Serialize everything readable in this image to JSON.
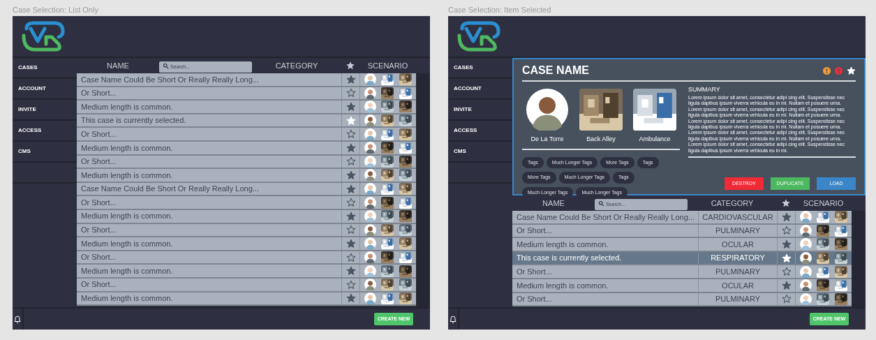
{
  "frames": [
    {
      "caption": "Case Selection: List Only",
      "sidebar": [
        "CASES",
        "ACCOUNT",
        "INVITE",
        "ACCESS",
        "CMS"
      ],
      "columns": {
        "name": "NAME",
        "category": "CATEGORY",
        "scenario": "SCENARIO"
      },
      "search": {
        "placeholder": "Search..."
      },
      "rows": [
        {
          "name": "Case Name Could Be Short Or Really Really Long...",
          "starred": true,
          "selected": false
        },
        {
          "name": "Or Short...",
          "starred": false,
          "selected": false
        },
        {
          "name": "Medium length is common.",
          "starred": true,
          "selected": false
        },
        {
          "name": "This case is currently selected.",
          "starred": true,
          "selected": true
        },
        {
          "name": "Or Short...",
          "starred": false,
          "selected": false
        },
        {
          "name": "Medium length is common.",
          "starred": true,
          "selected": false
        },
        {
          "name": "Or Short...",
          "starred": false,
          "selected": false
        },
        {
          "name": "Medium length is common.",
          "starred": true,
          "selected": false
        },
        {
          "name": "Case Name Could Be Short Or Really Really Long...",
          "starred": true,
          "selected": false
        },
        {
          "name": "Or Short...",
          "starred": false,
          "selected": false
        },
        {
          "name": "Medium length is common.",
          "starred": true,
          "selected": false
        },
        {
          "name": "Or Short...",
          "starred": false,
          "selected": false
        },
        {
          "name": "Medium length is common.",
          "starred": true,
          "selected": false
        },
        {
          "name": "Or Short...",
          "starred": false,
          "selected": false
        },
        {
          "name": "Medium length is common.",
          "starred": true,
          "selected": false
        },
        {
          "name": "Or Short...",
          "starred": false,
          "selected": false
        },
        {
          "name": "Medium length is common.",
          "starred": true,
          "selected": false
        }
      ],
      "create_button": "CREATE NEW"
    },
    {
      "caption": "Case Selection: Item Selected",
      "sidebar": [
        "CASES",
        "ACCOUNT",
        "INVITE",
        "ACCESS",
        "CMS"
      ],
      "columns": {
        "name": "NAME",
        "category": "CATEGORY",
        "scenario": "SCENARIO"
      },
      "search": {
        "placeholder": "Search..."
      },
      "detail": {
        "title": "CASE NAME",
        "starred": true,
        "assets": [
          {
            "kind": "avatar",
            "label": "De La Torre"
          },
          {
            "kind": "scene",
            "label": "Back Alley"
          },
          {
            "kind": "vehicle",
            "label": "Ambulance"
          }
        ],
        "tags": [
          "Tags",
          "Much Longer Tags",
          "More Tags",
          "Tags",
          "More Tags",
          "Much Longer Tags",
          "Tags",
          "Much Longer Tags",
          "Much Longer Tags"
        ],
        "summary_title": "SUMMARY",
        "summary": "Lorem ipsum dolor sit amet, consectetur adipi cing elit. Suspendisse nec ligula dapibus ipsum viverra vehicula eu in mi. Nullam et posuere urna. Lorem ipsum dolor sit amet, consectetur adipi cing elit. Suspendisse nec ligula dapibus ipsum viverra vehicula eu in mi. Nullam et posuere urna. Lorem ipsum dolor sit amet, consectetur adipi cing elit. Suspendisse nec ligula dapibus ipsum viverra vehicula eu in mi. Nullam et posuere urna. Lorem ipsum dolor sit amet, consectetur adipi cing elit. Suspendisse nec ligula dapibus ipsum viverra vehicula eu in mi. Nullam et posuere urna. Lorem ipsum dolor sit amet, consectetur adipi cing elit. Suspendisse nec ligula dapibus ipsum viverra vehicula eu in mi.",
        "buttons": [
          {
            "kind": "destroy",
            "label": "DESTROY"
          },
          {
            "kind": "duplicate",
            "label": "DUPLICATE"
          },
          {
            "kind": "load",
            "label": "LOAD"
          }
        ]
      },
      "rows": [
        {
          "name": "Case Name Could Be Short Or Really Really Long...",
          "category": "CARDIOVASCULAR",
          "starred": true,
          "selected": false
        },
        {
          "name": "Or Short...",
          "category": "PULMINARY",
          "starred": false,
          "selected": false
        },
        {
          "name": "Medium length is common.",
          "category": "OCULAR",
          "starred": true,
          "selected": false
        },
        {
          "name": "This case is currently selected.",
          "category": "RESPIRATORY",
          "starred": true,
          "selected": true
        },
        {
          "name": "Or Short...",
          "category": "PULMINARY",
          "starred": false,
          "selected": false
        },
        {
          "name": "Medium length is common.",
          "category": "OCULAR",
          "starred": true,
          "selected": false
        },
        {
          "name": "Or Short...",
          "category": "PULMINARY",
          "starred": false,
          "selected": false
        }
      ],
      "create_button": "CREATE NEW"
    }
  ]
}
